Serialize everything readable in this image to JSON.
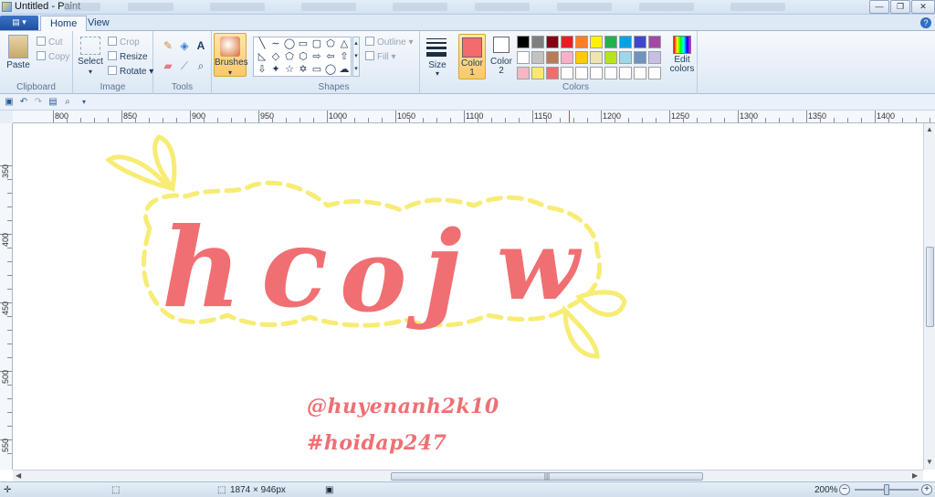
{
  "window": {
    "title": "Untitled - Paint",
    "minimize": "—",
    "maximize": "❐",
    "close": "✕"
  },
  "tabs": [
    {
      "label": "Home"
    },
    {
      "label": "View"
    }
  ],
  "app_menu_label": "▤ ▾",
  "help_label": "?",
  "ribbon": {
    "clipboard": {
      "label": "Clipboard",
      "paste": "Paste",
      "cut": "Cut",
      "copy": "Copy"
    },
    "image": {
      "label": "Image",
      "select": "Select",
      "crop": "Crop",
      "resize": "Resize",
      "rotate": "Rotate"
    },
    "tools": {
      "label": "Tools"
    },
    "brushes": {
      "label": "Brushes"
    },
    "shapes": {
      "label": "Shapes",
      "outline": "Outline",
      "fill": "Fill"
    },
    "size": {
      "label": "Size"
    },
    "color1": {
      "label1": "Color",
      "label2": "1",
      "value": "#f26b6f"
    },
    "color2": {
      "label1": "Color",
      "label2": "2",
      "value": "#ffffff"
    },
    "colors": {
      "label": "Colors"
    },
    "edit_colors": {
      "label1": "Edit",
      "label2": "colors"
    },
    "palette_row1": [
      "#000000",
      "#7f7f7f",
      "#880015",
      "#ed1c24",
      "#ff7f27",
      "#fff200",
      "#22b14c",
      "#00a2e8",
      "#3f48cc",
      "#a349a4"
    ],
    "palette_row2": [
      "#ffffff",
      "#c3c3c3",
      "#b97a57",
      "#ffaec9",
      "#ffc90e",
      "#efe4b0",
      "#b5e61d",
      "#99d9ea",
      "#7092be",
      "#c8bfe7"
    ],
    "palette_row3": [
      "#f5b7c4",
      "#fce86b",
      "#f26b6f",
      "#ffffff",
      "#ffffff",
      "#ffffff",
      "#ffffff",
      "#ffffff",
      "#ffffff",
      "#ffffff"
    ]
  },
  "ruler_h_labels": [
    "800",
    "850",
    "900",
    "950",
    "1000",
    "1050",
    "1100",
    "1150",
    "1200",
    "1250",
    "1300",
    "1350",
    "1400"
  ],
  "ruler_v_labels": [
    "350",
    "400",
    "450",
    "500",
    "550"
  ],
  "artwork": {
    "word": "hcojw",
    "handle": "@huyenanh2k10",
    "hashtag": "#hoidap247",
    "letter_color": "#f06f73",
    "outline_color": "#f7ec74"
  },
  "status": {
    "dimensions": "1874 × 946px",
    "zoom": "200%"
  }
}
